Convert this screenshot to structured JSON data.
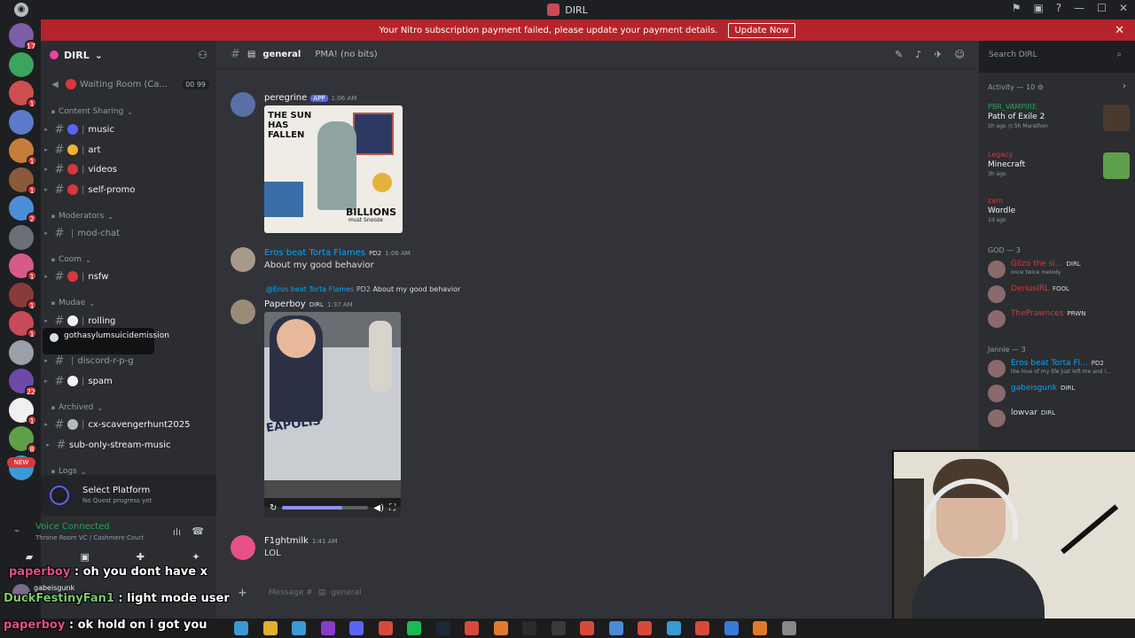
{
  "window": {
    "title": "DIRL"
  },
  "banner": {
    "text": "Your Nitro subscription payment failed, please update your payment details.",
    "button": "Update Now",
    "close": "✕"
  },
  "rail": {
    "servers": [
      {
        "color": "#7b5ea7",
        "badge": "17"
      },
      {
        "color": "#3ba55d",
        "badge": ""
      },
      {
        "color": "#cf4f4f",
        "badge": "1"
      },
      {
        "color": "#5a7bc9",
        "badge": ""
      },
      {
        "color": "#c77d3a",
        "badge": "1"
      },
      {
        "color": "#8a5a3a",
        "badge": "1"
      },
      {
        "color": "#4d8fd6",
        "badge": "2"
      },
      {
        "color": "#6a6f78",
        "badge": ""
      },
      {
        "color": "#d65a8a",
        "badge": "1"
      },
      {
        "color": "#8b3a3a",
        "badge": "1"
      },
      {
        "color": "#c94a5a",
        "badge": "1"
      },
      {
        "color": "#9aa0a8",
        "badge": ""
      },
      {
        "color": "#6e4aa8",
        "badge": "22"
      },
      {
        "color": "#f0f0f0",
        "badge": "1"
      },
      {
        "color": "#5ea04a",
        "badge": "8"
      },
      {
        "color": "#3a9ad6",
        "badge": ""
      }
    ],
    "new_label": "NEW"
  },
  "sidebar": {
    "guild_name": "DIRL",
    "rows": [
      {
        "kind": "voice",
        "label": "Waiting Room (Ca...",
        "counts": "00  99"
      },
      {
        "kind": "cat",
        "label": "Content Sharing"
      },
      {
        "kind": "chan",
        "label": "music",
        "emo": "#5865f2"
      },
      {
        "kind": "chan",
        "label": "art",
        "emo": "#f0b232"
      },
      {
        "kind": "chan",
        "label": "videos",
        "emo": "#da373c"
      },
      {
        "kind": "chan",
        "label": "self-promo",
        "emo": "#da373c"
      },
      {
        "kind": "cat",
        "label": "Moderators"
      },
      {
        "kind": "chan-muted",
        "label": "mod-chat"
      },
      {
        "kind": "cat",
        "label": "Coom"
      },
      {
        "kind": "chan",
        "label": "nsfw",
        "emo": "#da373c"
      },
      {
        "kind": "cat",
        "label": "Mudae"
      },
      {
        "kind": "chan",
        "label": "rolling",
        "emo": "#f2f3f5"
      },
      {
        "kind": "chan-muted",
        "label": "discord-r-p-g"
      },
      {
        "kind": "chan",
        "label": "spam",
        "emo": "#f2f3f5"
      },
      {
        "kind": "cat",
        "label": "Archived"
      },
      {
        "kind": "chan",
        "label": "cx-scavengerhunt2025",
        "emo": "#b5bac1"
      },
      {
        "kind": "chan-plain",
        "label": "sub-only-stream-music"
      },
      {
        "kind": "cat",
        "label": "Logs"
      }
    ],
    "tooltip": "gothasylumsuicidemission",
    "quest": {
      "title": "Select Platform",
      "subtitle": "No Quest progress yet"
    },
    "voice": {
      "status": "Voice Connected",
      "location": "Throne Room VC / Cashmere Court"
    },
    "user": {
      "name": "gabeisgunk"
    }
  },
  "overlay_chat": [
    {
      "name": "paperboy",
      "sep": " : ",
      "text": "oh you dont have x"
    },
    {
      "name": "DuckFestinyFan1",
      "sep": " : ",
      "text": "light mode user"
    },
    {
      "name": "paperboy",
      "sep": " : ",
      "text": "ok hold on i got you"
    }
  ],
  "channel": {
    "name": "general",
    "topic": "PMA! (no bits)"
  },
  "search": {
    "placeholder": "Search DIRL"
  },
  "messages": [
    {
      "author": "peregrine",
      "app_tag": "APP",
      "time": "1:06 AM",
      "color": "#f2f3f5"
    },
    {
      "author": "Eros beat Torta Flames",
      "tag": "PD2",
      "time": "1:06 AM",
      "text": "About my good behavior",
      "color": "#00a8fc"
    },
    {
      "reply_name": "@Eros beat Torta Flames",
      "reply_tag": "PD2",
      "reply_text": "About my good behavior",
      "author": "Paperboy",
      "tag": "DIRL",
      "time": "1:37 AM",
      "color": "#f2f3f5"
    },
    {
      "author": "F1ghtmilk",
      "time": "1:41 AM",
      "text": "LOL",
      "color": "#f2f3f5"
    }
  ],
  "meme": {
    "caption": "THE SUN HAS FALLEN",
    "billions": "BILLIONS",
    "must": "must Snooze"
  },
  "video": {
    "plate": "EAPOLIS"
  },
  "composer": {
    "placeholder": "Message #",
    "channel": "general"
  },
  "activity": {
    "header": "Activity — 10",
    "cards": [
      {
        "user": "PBR_VAMPIRE",
        "game": "Path of Exile 2",
        "meta": "5h ago  ◷ 5h Marathon",
        "color": "#23a55a",
        "thumb": "#4a3a2e"
      },
      {
        "user": "Legacy",
        "game": "Minecraft",
        "meta": "3h ago",
        "color": "#da373c",
        "thumb": "#5ea04a"
      },
      {
        "user": "zam",
        "game": "Wordle",
        "meta": "1d ago",
        "color": "#da373c",
        "thumb": "#2b2d31"
      }
    ],
    "groups": [
      {
        "label": "GOD — 3",
        "members": [
          {
            "name": "Glizo the si...",
            "tag": "DIRL",
            "status": "once twice melody",
            "color": "#da373c"
          },
          {
            "name": "DeriusIRL",
            "tag": "FOOL",
            "status": "",
            "color": "#da373c"
          },
          {
            "name": "ThePrawnces",
            "tag": "PRWN",
            "status": "",
            "color": "#da373c"
          }
        ]
      },
      {
        "label": "Jannie — 3",
        "members": [
          {
            "name": "Eros beat Torta Fl...",
            "tag": "PD2",
            "status": "the love of my life just left me and i...",
            "color": "#00a8fc"
          },
          {
            "name": "gabeisgunk",
            "tag": "DIRL",
            "status": "",
            "color": "#00a8fc"
          },
          {
            "name": "lowvar",
            "tag": "DIRL",
            "status": "",
            "color": "#dbdee1"
          }
        ]
      }
    ]
  },
  "taskbar": {
    "icons": [
      "#3a9ad6",
      "#e0b030",
      "#3a9ad6",
      "#8a3ac9",
      "#5865f2",
      "#d64a3a",
      "#1db954",
      "#1b2838",
      "#d64a3a",
      "#e07a2a",
      "#2a2a2a",
      "#3a3a3a",
      "#d64a3a",
      "#4a8ad6",
      "#d64a3a",
      "#3a9ad6",
      "#d64a3a",
      "#3a7ad6",
      "#e07a2a",
      "#888888"
    ]
  }
}
